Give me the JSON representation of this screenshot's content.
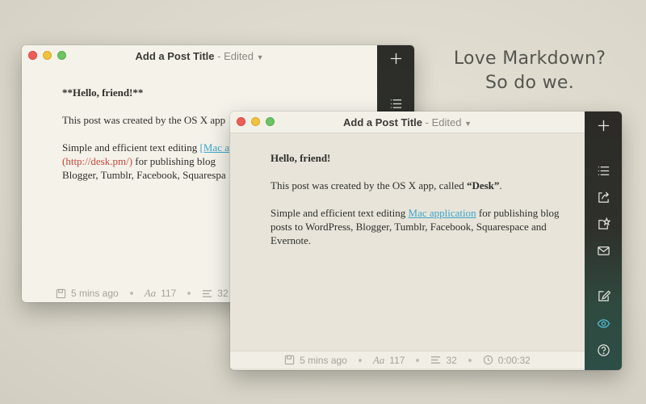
{
  "tagline": {
    "line1": "Love Markdown?",
    "line2": "So do we."
  },
  "back_window": {
    "title": "Add a Post Title",
    "separator": " - ",
    "state": "Edited",
    "doc": {
      "heading": "**Hello, friend!**",
      "p1": "This post was created by the OS X app",
      "p2_prefix": "Simple and efficient text editing ",
      "p2_link": "[Mac a",
      "p2_url": "(http://desk.pm/)",
      "p2_suffix": " for publishing blog",
      "p2_line3": "Blogger, Tumblr, Facebook, Squarespa"
    },
    "status": {
      "time": "5 mins ago",
      "chars": "117",
      "words": "32"
    }
  },
  "front_window": {
    "title": "Add a Post Title",
    "separator": " - ",
    "state": "Edited",
    "doc": {
      "heading": "Hello, friend!",
      "p1_prefix": "This post was created by the OS X app, called ",
      "p1_bold": "“Desk”",
      "p1_suffix": ".",
      "p2_prefix": "Simple and efficient text editing ",
      "p2_link": "Mac application",
      "p2_suffix": " for publishing blog posts to WordPress, Blogger, Tumblr, Facebook, Squarespace and Evernote."
    },
    "status": {
      "time": "5 mins ago",
      "chars": "117",
      "words": "32",
      "duration": "0:00:32"
    }
  },
  "colors": {
    "link": "#3aa6c8",
    "url": "#c4483a",
    "preview_active": "#53b7d3",
    "close": "#ec5f57",
    "minimize": "#f0c33a",
    "zoom": "#6cc462"
  },
  "icons": {
    "sidebar": [
      "plus-icon",
      "list-icon",
      "share-icon",
      "publish-icon",
      "mail-icon",
      "edit-icon",
      "eye-icon",
      "help-icon"
    ],
    "status": [
      "save-icon",
      "font-icon",
      "lines-icon",
      "clock-icon"
    ]
  }
}
